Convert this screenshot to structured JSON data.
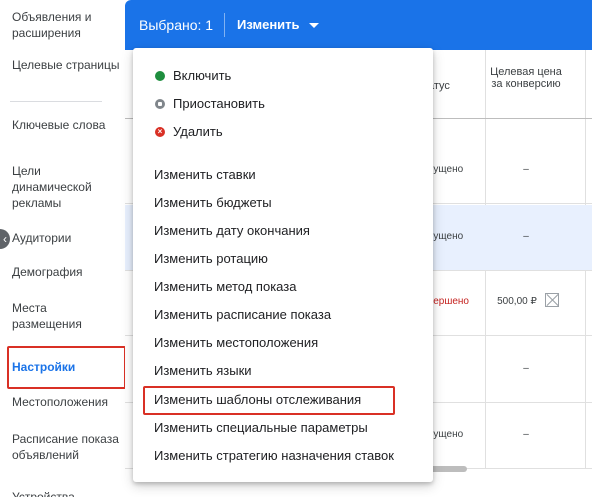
{
  "sidebar": {
    "items": [
      {
        "label": "Объявления и расширения"
      },
      {
        "label": "Целевые страницы"
      },
      {
        "label": "Ключевые слова"
      },
      {
        "label": "Цели динамической рекламы"
      },
      {
        "label": "Аудитории"
      },
      {
        "label": "Демография"
      },
      {
        "label": "Места размещения"
      },
      {
        "label": "Настройки"
      },
      {
        "label": "Местоположения"
      },
      {
        "label": "Расписание показа объявлений"
      },
      {
        "label": "Устройства"
      }
    ],
    "selected_color": "#1a73e8"
  },
  "topbar": {
    "selected_label": "Выбрано: 1",
    "edit_label": "Изменить",
    "background": "#1a73e8"
  },
  "table": {
    "headers": {
      "status": "атус",
      "target": "Целевая цена за конверсию"
    },
    "rows": [
      {
        "status": "пущено",
        "target": "–"
      },
      {
        "status": "пущено",
        "target": "–"
      },
      {
        "status": "вершено",
        "target": "500,00 ₽"
      },
      {
        "status": "",
        "target": "–"
      },
      {
        "status": "пущено",
        "target": "–"
      }
    ]
  },
  "menu": {
    "status_actions": [
      {
        "label": "Включить",
        "icon": "green-dot-icon"
      },
      {
        "label": "Приостановить",
        "icon": "pause-dot-icon"
      },
      {
        "label": "Удалить",
        "icon": "remove-dot-icon"
      }
    ],
    "edit_actions": [
      "Изменить ставки",
      "Изменить бюджеты",
      "Изменить дату окончания",
      "Изменить ротацию",
      "Изменить метод показа",
      "Изменить расписание показа",
      "Изменить местоположения",
      "Изменить языки",
      "Изменить шаблоны отслеживания",
      "Изменить специальные параметры",
      "Изменить стратегию назначения ставок"
    ],
    "remove_glyph": "×"
  }
}
